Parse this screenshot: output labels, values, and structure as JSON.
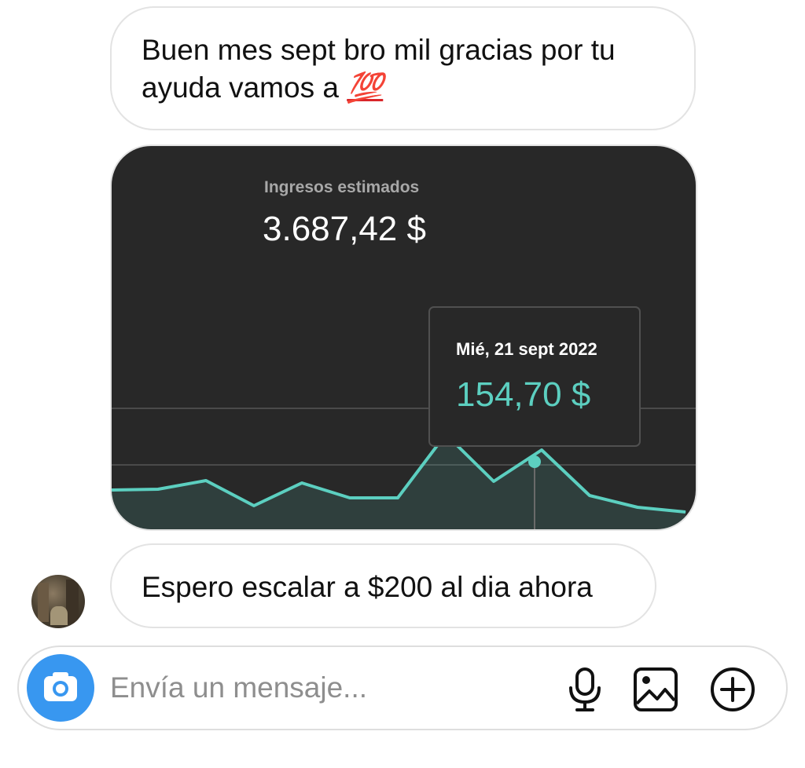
{
  "messages": [
    {
      "text_line1": "Buen mes sept bro mil gracias por tu",
      "text_line2": "ayuda vamos a ",
      "emoji": "💯"
    },
    {
      "text": "Espero escalar a $200 al dia ahora"
    }
  ],
  "card": {
    "metric_label": "Ingresos estimados",
    "metric_value": "3.687,42 $",
    "tooltip_date": "Mié, 21 sept 2022",
    "tooltip_value": "154,70 $",
    "line_color": "#5ccfc0",
    "background": "#282828"
  },
  "chart_data": {
    "type": "area",
    "title": "Ingresos estimados",
    "series": [
      {
        "values": [
          32,
          33,
          44,
          12,
          41,
          22,
          22,
          103,
          43,
          83,
          25,
          10,
          4
        ]
      }
    ],
    "highlight": {
      "label": "Mié, 21 sept 2022",
      "value": "154,70 $"
    }
  },
  "composer": {
    "placeholder": "Envía un mensaje...",
    "icons": [
      "camera-icon",
      "microphone-icon",
      "gallery-icon",
      "plus-icon"
    ],
    "accent": "#3897f0"
  }
}
